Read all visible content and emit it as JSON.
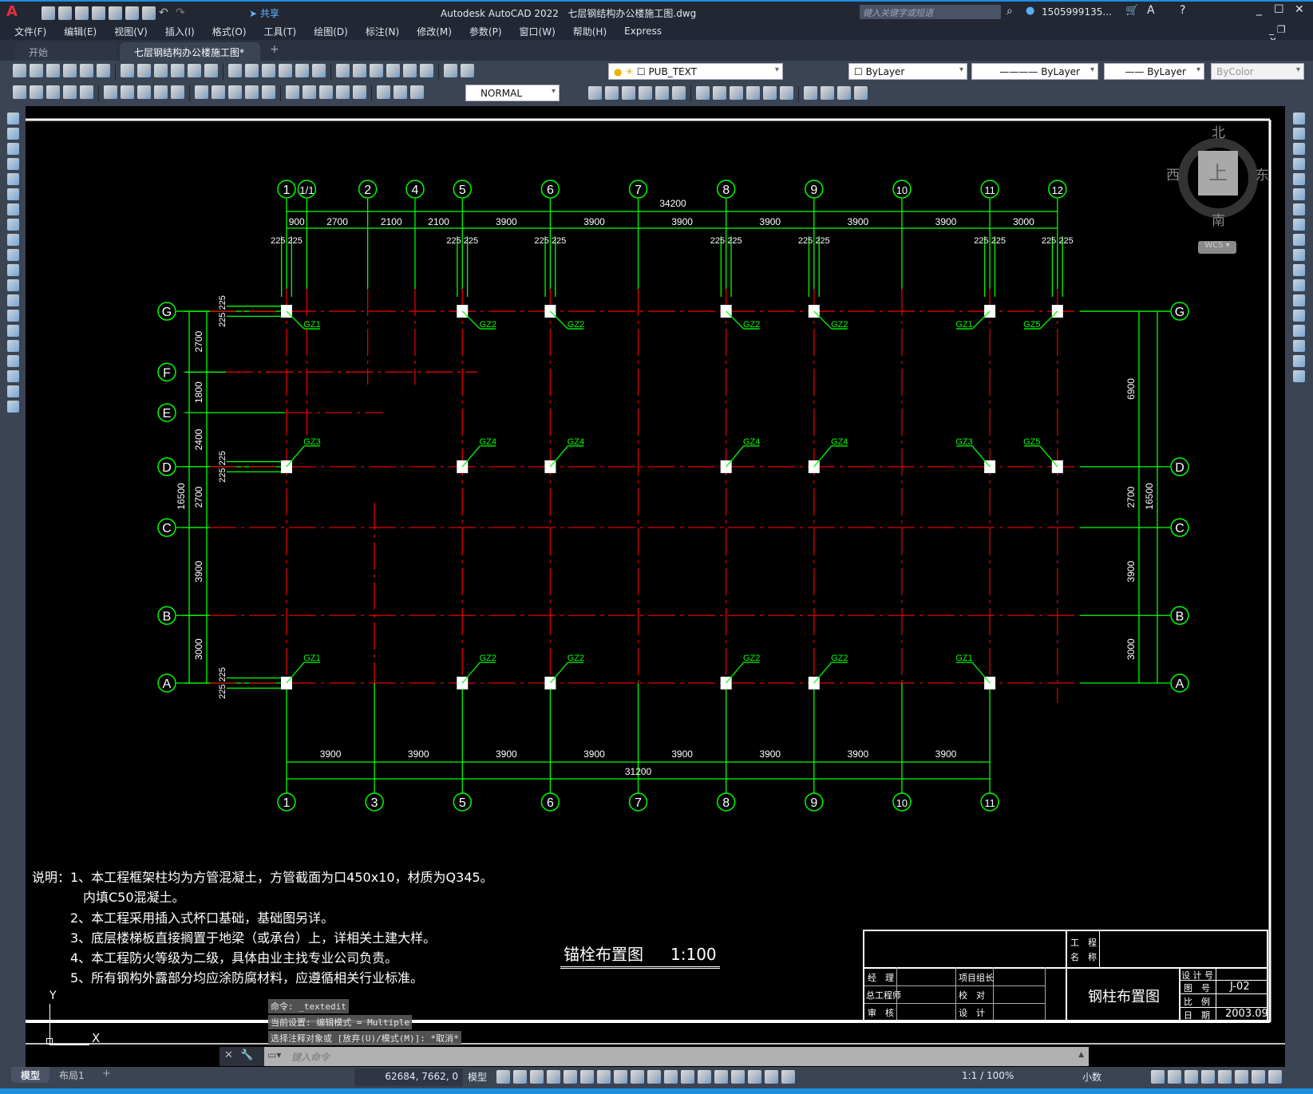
{
  "app": {
    "logo": "A",
    "title": "Autodesk AutoCAD 2022",
    "filename": "七层钢结构办公楼施工图.dwg",
    "share": "共享",
    "search_placeholder": "键入关键字或短语",
    "user": "1505999135...",
    "accent": "#1d8fe0"
  },
  "menu": [
    "文件(F)",
    "编辑(E)",
    "视图(V)",
    "插入(I)",
    "格式(O)",
    "工具(T)",
    "绘图(D)",
    "标注(N)",
    "修改(M)",
    "参数(P)",
    "窗口(W)",
    "帮助(H)",
    "Express"
  ],
  "tabs": {
    "start": "开始",
    "active": "七层钢结构办公楼施工图*",
    "close": "✕",
    "add": "+"
  },
  "toolbar1": {
    "icons": [
      "new-icon",
      "open-icon",
      "save-icon",
      "print-icon",
      "print-preview-icon",
      "plot-icon",
      "publish-icon",
      "cut-icon",
      "copy-icon",
      "paste-icon",
      "match-properties-icon",
      "block-editor-icon",
      "undo-icon",
      "redo-icon",
      "pan-icon",
      "zoom-realtime-icon",
      "zoom-window-icon",
      "zoom-previous-icon",
      "properties-icon",
      "design-center-icon",
      "tool-palettes-icon",
      "sheet-set-icon",
      "markup-icon",
      "calculator-icon",
      "help-icon",
      "layer-properties-icon"
    ],
    "layer": "PUB_TEXT",
    "color": "ByLayer",
    "linetype": "ByLayer",
    "lineweight": "ByLayer",
    "plotstyle": "ByColor"
  },
  "toolbar2": {
    "icons": [
      "layer-state-icon",
      "make-current-icon",
      "layer-previous-icon",
      "dim-linear-icon",
      "dim-aligned-icon",
      "dim-arc-icon",
      "dim-ordinate-icon",
      "dim-radius-icon",
      "dim-jogged-icon",
      "dim-diameter-icon",
      "dim-angular-icon",
      "quick-dim-icon",
      "dim-baseline-icon",
      "dim-continue-icon",
      "dim-space-icon",
      "dim-break-icon",
      "tolerance-icon",
      "center-mark-icon",
      "inspect-icon",
      "jogged-linear-icon",
      "dim-edit-icon",
      "dim-text-edit-icon",
      "dim-update-icon"
    ],
    "dimstyle": "NORMAL",
    "icons2": [
      "erase-icon",
      "copy-object-icon",
      "mirror-icon",
      "offset-icon",
      "array-icon",
      "move-icon",
      "rotate-icon",
      "scale-icon",
      "stretch-icon",
      "trim-icon",
      "extend-icon",
      "break-icon",
      "join-icon",
      "chamfer-icon",
      "fillet-icon",
      "explode-icon"
    ]
  },
  "left_tools": [
    "line-icon",
    "construction-line-icon",
    "polyline-icon",
    "polygon-icon",
    "rectangle-icon",
    "arc-icon",
    "circle-icon",
    "revision-cloud-icon",
    "spline-icon",
    "ellipse-icon",
    "ellipse-arc-icon",
    "insert-block-icon",
    "make-block-icon",
    "point-icon",
    "hatch-icon",
    "gradient-icon",
    "region-icon",
    "table-icon",
    "mtext-icon",
    "add-selected-icon"
  ],
  "right_tools": [
    "erase-icon",
    "copy-icon",
    "mirror-icon",
    "offset-icon",
    "array-icon",
    "move-icon",
    "rotate-icon",
    "scale-icon",
    "stretch-icon",
    "trim-icon",
    "extend-icon",
    "break-at-point-icon",
    "break-icon",
    "join-icon",
    "chamfer-icon",
    "fillet-icon",
    "blend-icon",
    "explode-icon"
  ],
  "viewcube": {
    "north": "北",
    "south": "南",
    "west": "西",
    "east": "东",
    "face": "上",
    "wcs": "WCS"
  },
  "drawing": {
    "top_axes": [
      {
        "n": "1",
        "mm": 0
      },
      {
        "n": "1/1",
        "mm": 900
      },
      {
        "n": "2",
        "mm": 3600
      },
      {
        "n": "4",
        "mm": 5700
      },
      {
        "n": "5",
        "mm": 7800
      },
      {
        "n": "6",
        "mm": 11700
      },
      {
        "n": "7",
        "mm": 15600
      },
      {
        "n": "8",
        "mm": 19500
      },
      {
        "n": "9",
        "mm": 23400
      },
      {
        "n": "10",
        "mm": 27300
      },
      {
        "n": "11",
        "mm": 31200
      },
      {
        "n": "12",
        "mm": 34200
      }
    ],
    "bottom_axes": [
      {
        "n": "1",
        "mm": 0
      },
      {
        "n": "3",
        "mm": 3900
      },
      {
        "n": "5",
        "mm": 7800
      },
      {
        "n": "6",
        "mm": 11700
      },
      {
        "n": "7",
        "mm": 15600
      },
      {
        "n": "8",
        "mm": 19500
      },
      {
        "n": "9",
        "mm": 23400
      },
      {
        "n": "10",
        "mm": 27300
      },
      {
        "n": "11",
        "mm": 31200
      }
    ],
    "rows": [
      {
        "n": "A",
        "mm": 0
      },
      {
        "n": "B",
        "mm": 3000
      },
      {
        "n": "C",
        "mm": 6900
      },
      {
        "n": "D",
        "mm": 9600
      },
      {
        "n": "E",
        "mm": 12000
      },
      {
        "n": "F",
        "mm": 13800
      },
      {
        "n": "G",
        "mm": 16500
      }
    ],
    "top_total": "34200",
    "top_dims": [
      "900",
      "2700",
      "2100",
      "2100",
      "3900",
      "3900",
      "3900",
      "3900",
      "3900",
      "3900",
      "3000"
    ],
    "offset_dim": "225",
    "bottom_total": "31200",
    "bottom_dims": [
      "3900",
      "3900",
      "3900",
      "3900",
      "3900",
      "3900",
      "3900",
      "3900"
    ],
    "left_total": "16500",
    "left_dims": [
      "3000",
      "3900",
      "2700",
      "2400",
      "1800",
      "2700"
    ],
    "right_total": "16500",
    "right_dims": [
      "3000",
      "3900",
      "2700",
      "6900"
    ],
    "columns": [
      {
        "row": "G",
        "axis": "1",
        "label": "GZ1"
      },
      {
        "row": "G",
        "axis": "5",
        "label": "GZ2"
      },
      {
        "row": "G",
        "axis": "6",
        "label": "GZ2"
      },
      {
        "row": "G",
        "axis": "8",
        "label": "GZ2"
      },
      {
        "row": "G",
        "axis": "9",
        "label": "GZ2"
      },
      {
        "row": "G",
        "axis": "11",
        "label": "GZ1"
      },
      {
        "row": "G",
        "axis": "12",
        "label": "GZ5"
      },
      {
        "row": "D",
        "axis": "1",
        "label": "GZ3"
      },
      {
        "row": "D",
        "axis": "5",
        "label": "GZ4"
      },
      {
        "row": "D",
        "axis": "6",
        "label": "GZ4"
      },
      {
        "row": "D",
        "axis": "8",
        "label": "GZ4"
      },
      {
        "row": "D",
        "axis": "9",
        "label": "GZ4"
      },
      {
        "row": "D",
        "axis": "11",
        "label": "GZ3"
      },
      {
        "row": "D",
        "axis": "12",
        "label": "GZ5"
      },
      {
        "row": "A",
        "axis": "1",
        "label": "GZ1"
      },
      {
        "row": "A",
        "axis": "5",
        "label": "GZ2"
      },
      {
        "row": "A",
        "axis": "6",
        "label": "GZ2"
      },
      {
        "row": "A",
        "axis": "8",
        "label": "GZ2"
      },
      {
        "row": "A",
        "axis": "9",
        "label": "GZ2"
      },
      {
        "row": "A",
        "axis": "11",
        "label": "GZ1"
      }
    ],
    "colors": {
      "axis": "#00ff00",
      "grid": "#e00000",
      "text": "#ffffff",
      "column": "#ffffff"
    }
  },
  "notes": [
    "说明：1、本工程框架柱均为方管混凝土，方管截面为口450x10，材质为Q345。",
    "　　　　内填C50混凝土。",
    "　　　2、本工程采用插入式杯口基础，基础图另详。",
    "　　　3、底层楼梯板直接搁置于地梁（或承台）上，详相关土建大样。",
    "　　　4、本工程防火等级为二级，具体由业主找专业公司负责。",
    "　　　5、所有钢构外露部分均应涂防腐材料，应遵循相关行业标准。"
  ],
  "drawing_title": {
    "name": "锚栓布置图",
    "scale": "1:100"
  },
  "title_block": {
    "project_label_1": "工　程",
    "project_label_2": "名　称",
    "manager": "经　理",
    "chief_engineer": "总工程师",
    "review": "审　核",
    "team_lead": "项目组长",
    "check": "校　对",
    "design": "设　计",
    "drawing_name": "钢柱布置图",
    "design_no": "设 计 号",
    "drawing_no_label": "图　号",
    "drawing_no": "J-02",
    "scale_label": "比　例",
    "date_label": "日　期",
    "date": "2003.09"
  },
  "ucs": {
    "x": "X",
    "y": "Y"
  },
  "command": {
    "history": [
      "命令: _textedit",
      "当前设置: 编辑模式 = Multiple",
      "选择注释对象或 [放弃(U)/模式(M)]: *取消*"
    ],
    "placeholder": "键入命令"
  },
  "status": {
    "layout_tabs": [
      "模型",
      "布局1"
    ],
    "add": "+",
    "coords": "62684, 7662, 0",
    "space": "模型",
    "annoscale": "1:1 / 100%",
    "units": "小数"
  }
}
